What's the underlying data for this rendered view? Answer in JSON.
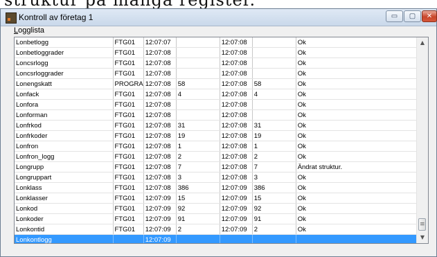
{
  "background_text": "struktur på många register.",
  "window": {
    "title": "Kontroll av företag 1"
  },
  "controls": {
    "minimize": "▭",
    "maximize": "▢",
    "close": "✕"
  },
  "group": {
    "label_underlined": "L",
    "label_rest": "ogglista"
  },
  "rows": [
    [
      "Lonbetlogg",
      "FTG01",
      "12:07:07",
      "",
      "12:07:08",
      "",
      "Ok"
    ],
    [
      "Lonbetloggrader",
      "FTG01",
      "12:07:08",
      "",
      "12:07:08",
      "",
      "Ok"
    ],
    [
      "Loncsrlogg",
      "FTG01",
      "12:07:08",
      "",
      "12:07:08",
      "",
      "Ok"
    ],
    [
      "Loncsrloggrader",
      "FTG01",
      "12:07:08",
      "",
      "12:07:08",
      "",
      "Ok"
    ],
    [
      "Lonengskatt",
      "PROGRA",
      "12:07:08",
      "58",
      "12:07:08",
      "58",
      "Ok"
    ],
    [
      "Lonfack",
      "FTG01",
      "12:07:08",
      "4",
      "12:07:08",
      "4",
      "Ok"
    ],
    [
      "Lonfora",
      "FTG01",
      "12:07:08",
      "",
      "12:07:08",
      "",
      "Ok"
    ],
    [
      "Lonforman",
      "FTG01",
      "12:07:08",
      "",
      "12:07:08",
      "",
      "Ok"
    ],
    [
      "Lonfrkod",
      "FTG01",
      "12:07:08",
      "31",
      "12:07:08",
      "31",
      "Ok"
    ],
    [
      "Lonfrkoder",
      "FTG01",
      "12:07:08",
      "19",
      "12:07:08",
      "19",
      "Ok"
    ],
    [
      "Lonfron",
      "FTG01",
      "12:07:08",
      "1",
      "12:07:08",
      "1",
      "Ok"
    ],
    [
      "Lonfron_logg",
      "FTG01",
      "12:07:08",
      "2",
      "12:07:08",
      "2",
      "Ok"
    ],
    [
      "Longrupp",
      "FTG01",
      "12:07:08",
      "7",
      "12:07:08",
      "7",
      "Ändrat struktur."
    ],
    [
      "Longruppart",
      "FTG01",
      "12:07:08",
      "3",
      "12:07:08",
      "3",
      "Ok"
    ],
    [
      "Lonklass",
      "FTG01",
      "12:07:08",
      "386",
      "12:07:09",
      "386",
      "Ok"
    ],
    [
      "Lonklasser",
      "FTG01",
      "12:07:09",
      "15",
      "12:07:09",
      "15",
      "Ok"
    ],
    [
      "Lonkod",
      "FTG01",
      "12:07:09",
      "92",
      "12:07:09",
      "92",
      "Ok"
    ],
    [
      "Lonkoder",
      "FTG01",
      "12:07:09",
      "91",
      "12:07:09",
      "91",
      "Ok"
    ],
    [
      "Lonkontid",
      "FTG01",
      "12:07:09",
      "2",
      "12:07:09",
      "2",
      "Ok"
    ],
    [
      "Lonkontlogg",
      "",
      "12:07:09",
      "",
      "",
      "",
      ""
    ]
  ],
  "selected_row": 19,
  "colors": {
    "selection": "#3399ff"
  }
}
